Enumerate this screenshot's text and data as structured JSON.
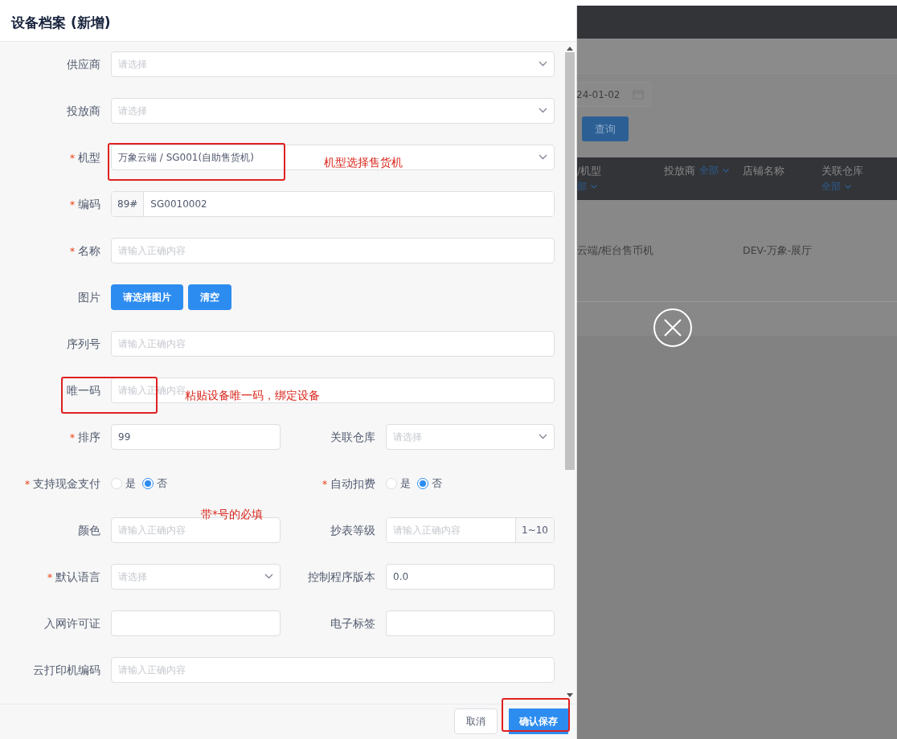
{
  "dialog": {
    "title": "设备档案 (新增)",
    "required_mark": "*",
    "rows": [
      {
        "items": [
          {
            "kind": "select",
            "label": "供应商",
            "required": false,
            "placeholder": "请选择"
          }
        ]
      },
      {
        "items": [
          {
            "kind": "select",
            "label": "投放商",
            "required": false,
            "placeholder": "请选择"
          }
        ]
      },
      {
        "items": [
          {
            "kind": "select",
            "label": "机型",
            "required": true,
            "value": "万象云端 / SG001(自助售货机)"
          }
        ]
      },
      {
        "items": [
          {
            "kind": "prefix",
            "label": "编码",
            "required": true,
            "prefix": "89#",
            "value": "SG0010002"
          }
        ]
      },
      {
        "items": [
          {
            "kind": "input",
            "label": "名称",
            "required": true,
            "placeholder": "请输入正确内容"
          }
        ]
      },
      {
        "items": [
          {
            "kind": "buttons",
            "label": "图片",
            "required": false,
            "buttons": [
              "请选择图片",
              "清空"
            ]
          }
        ]
      },
      {
        "items": [
          {
            "kind": "input",
            "label": "序列号",
            "required": false,
            "placeholder": "请输入正确内容"
          }
        ]
      },
      {
        "items": [
          {
            "kind": "input",
            "label": "唯一码",
            "required": false,
            "placeholder": "请输入正确内容"
          }
        ]
      },
      {
        "items": [
          {
            "kind": "input",
            "label": "排序",
            "required": true,
            "value": "99"
          },
          {
            "kind": "select",
            "label": "关联仓库",
            "required": false,
            "placeholder": "请选择"
          }
        ]
      },
      {
        "items": [
          {
            "kind": "radio",
            "label": "支持现金支付",
            "required": true,
            "options": [
              {
                "label": "是",
                "selected": false
              },
              {
                "label": "否",
                "selected": true
              }
            ]
          },
          {
            "kind": "radio",
            "label": "自动扣费",
            "required": true,
            "options": [
              {
                "label": "是",
                "selected": false
              },
              {
                "label": "否",
                "selected": true
              }
            ]
          }
        ]
      },
      {
        "items": [
          {
            "kind": "input",
            "label": "颜色",
            "required": false,
            "placeholder": "请输入正确内容"
          },
          {
            "kind": "suffix",
            "label": "抄表等级",
            "required": false,
            "placeholder": "请输入正确内容",
            "suffix": "1~10"
          }
        ]
      },
      {
        "items": [
          {
            "kind": "select",
            "label": "默认语言",
            "required": true,
            "placeholder": "请选择"
          },
          {
            "kind": "input",
            "label": "控制程序版本",
            "required": false,
            "value": "0.0"
          }
        ]
      },
      {
        "items": [
          {
            "kind": "input",
            "label": "入网许可证",
            "required": false
          },
          {
            "kind": "input",
            "label": "电子标签",
            "required": false
          }
        ]
      },
      {
        "items": [
          {
            "kind": "input",
            "label": "云打印机编码",
            "required": false,
            "placeholder": "请输入正确内容"
          }
        ]
      }
    ],
    "cancel_button": "取消",
    "confirm_button": "确认保存"
  },
  "background": {
    "date_value": "24-01-02",
    "query_button": "查询",
    "columns": [
      {
        "label": "/机型",
        "filter": "部",
        "cell": "云端/柜台售币机"
      },
      {
        "label": "投放商",
        "filter": "全部"
      },
      {
        "label": "店铺名称",
        "cell": "DEV-万象-展厅"
      },
      {
        "label": "关联仓库",
        "filter": "全部"
      }
    ]
  },
  "annotations": [
    {
      "kind": "text",
      "text": "机型选择售货机"
    },
    {
      "kind": "text",
      "text": "粘贴设备唯一码，绑定设备"
    },
    {
      "kind": "text",
      "text": "带*号的必填"
    }
  ]
}
